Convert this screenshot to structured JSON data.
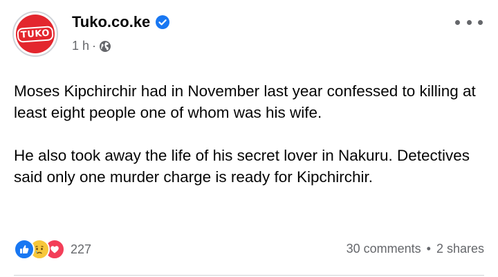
{
  "page": {
    "name": "Tuko.co.ke",
    "logo_text": "TUKO",
    "time": "1 h",
    "separator": "·"
  },
  "post": {
    "paragraphs": [
      "Moses Kipchirchir had in November last year confessed to killing at least eight people one of whom was his wife.",
      "He also took away the life of his secret lover in Nakuru. Detectives said only one murder charge is ready for Kipchirchir."
    ]
  },
  "reactions": {
    "icons": [
      "like-icon",
      "sad-icon",
      "love-icon"
    ],
    "count": "227"
  },
  "stats": {
    "comments": "30 comments",
    "bullet": "•",
    "shares": "2 shares"
  },
  "colors": {
    "brand_red": "#e3262e",
    "verified_blue": "#1877f2",
    "meta_gray": "#65676b"
  }
}
